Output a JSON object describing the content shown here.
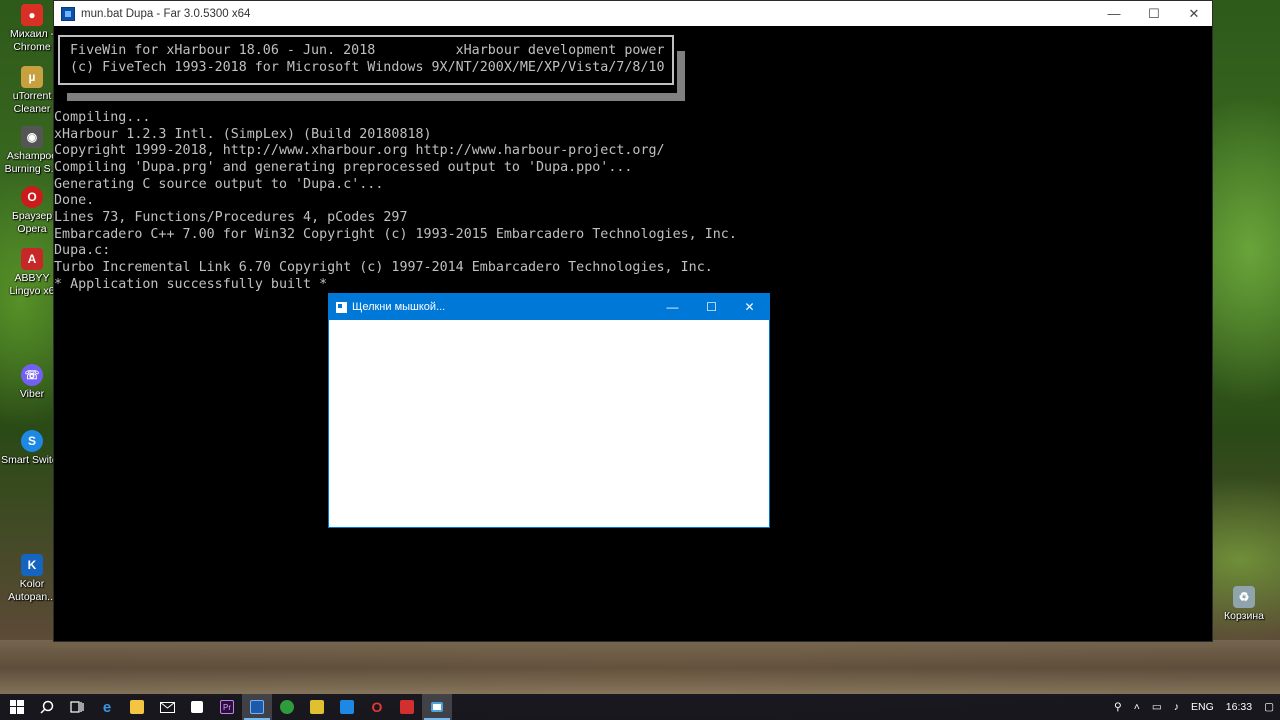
{
  "desktop": {
    "icons": [
      {
        "label": "Михаил - Chrome",
        "icon": "chrome-icon",
        "color": "#d93025"
      },
      {
        "label": "uTorrent Cleaner",
        "icon": "utorrent-icon",
        "color": "#c8a040"
      },
      {
        "label": "Ashampoo Burning S...",
        "icon": "ashampoo-icon",
        "color": "#555555"
      },
      {
        "label": "Браузер Opera",
        "icon": "opera-icon",
        "color": "#cc1b1b"
      },
      {
        "label": "ABBYY Lingvo x6",
        "icon": "abbyy-icon",
        "color": "#c62828"
      },
      {
        "label": "Viber",
        "icon": "viber-icon",
        "color": "#7360f2"
      },
      {
        "label": "Smart Switch",
        "icon": "smart-switch-icon",
        "color": "#1e88e5"
      },
      {
        "label": "Kolor Autopan...",
        "icon": "kolor-icon",
        "color": "#1565c0"
      },
      {
        "label": "Корзина",
        "icon": "recycle-bin-icon",
        "color": "#90a4ae"
      }
    ]
  },
  "far_window": {
    "title": "mun.bat Dupa - Far 3.0.5300 x64",
    "minimize": "—",
    "maximize": "☐",
    "close": "✕"
  },
  "console": {
    "banner": [
      "FiveWin for xHarbour 18.06 - Jun. 2018          xHarbour development power",
      "(c) FiveTech 1993-2018 for Microsoft Windows 9X/NT/200X/ME/XP/Vista/7/8/10"
    ],
    "lines": [
      "Compiling...",
      "xHarbour 1.2.3 Intl. (SimpLex) (Build 20180818)",
      "Copyright 1999-2018, http://www.xharbour.org http://www.harbour-project.org/",
      "Compiling 'Dupa.prg' and generating preprocessed output to 'Dupa.ppo'...",
      "Generating C source output to 'Dupa.c'...",
      "Done.",
      "Lines 73, Functions/Procedures 4, pCodes 297",
      "Embarcadero C++ 7.00 for Win32 Copyright (c) 1993-2015 Embarcadero Technologies, Inc.",
      "Dupa.c:",
      "Turbo Incremental Link 6.70 Copyright (c) 1997-2014 Embarcadero Technologies, Inc.",
      "* Application successfully built *"
    ]
  },
  "popup": {
    "title": "Щелкни мышкой...",
    "minimize": "—",
    "maximize": "☐",
    "close": "✕"
  },
  "taskbar": {
    "items": [
      {
        "icon": "windows-start-icon",
        "color": "#ffffff",
        "active": false
      },
      {
        "icon": "search-icon",
        "color": "#ffffff",
        "active": false
      },
      {
        "icon": "task-view-icon",
        "color": "#ffffff",
        "active": false
      },
      {
        "icon": "edge-icon",
        "color": "#3277bc",
        "active": false
      },
      {
        "icon": "file-explorer-icon",
        "color": "#f4c542",
        "active": false
      },
      {
        "icon": "mail-icon",
        "color": "#ffffff",
        "active": false
      },
      {
        "icon": "store-icon",
        "color": "#ffffff",
        "active": false
      },
      {
        "icon": "premiere-icon",
        "color": "#6a2c91",
        "active": false
      },
      {
        "icon": "far-manager-icon",
        "color": "#1e5aa8",
        "active": true
      },
      {
        "icon": "greenshot-icon",
        "color": "#2e9c3c",
        "active": false
      },
      {
        "icon": "game-icon",
        "color": "#e0c030",
        "active": false
      },
      {
        "icon": "app-blue-icon",
        "color": "#1e88e5",
        "active": false
      },
      {
        "icon": "opera-icon",
        "color": "#cc1b1b",
        "active": false
      },
      {
        "icon": "app-red-icon",
        "color": "#d32f2f",
        "active": false
      },
      {
        "icon": "window-app-icon",
        "color": "#4aa3df",
        "active": true
      }
    ],
    "tray": {
      "language": "ENG",
      "time": "16:33"
    }
  }
}
